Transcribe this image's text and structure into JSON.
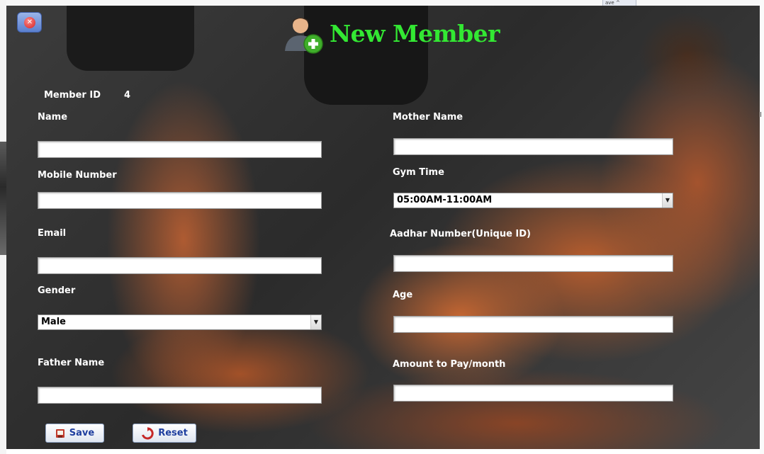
{
  "window": {
    "title": "New Member"
  },
  "form": {
    "member_id_label": "Member ID",
    "member_id_value": "4",
    "name_label": "Name",
    "mobile_label": "Mobile Number",
    "email_label": "Email",
    "gender_label": "Gender",
    "gender_selected": "Male",
    "father_label": "Father Name",
    "mother_label": "Mother Name",
    "gym_time_label": "Gym Time",
    "gym_time_selected": "05:00AM-11:00AM",
    "aadhar_label": "Aadhar Number(Unique ID)",
    "age_label": "Age",
    "amount_label": "Amount to Pay/month"
  },
  "buttons": {
    "save": "Save",
    "reset": "Reset"
  },
  "background": {
    "top_peek": "ave ^",
    "side_marks": [
      "*",
      "*"
    ],
    "right_mark": "I"
  },
  "colors": {
    "title_green": "#33e833",
    "button_text": "#1f3f9f",
    "label_white": "#ffffff"
  },
  "icons": {
    "close": "close-icon",
    "add_user": "add-user-icon",
    "save": "save-icon",
    "reset": "refresh-icon",
    "dropdown": "chevron-down-icon"
  }
}
